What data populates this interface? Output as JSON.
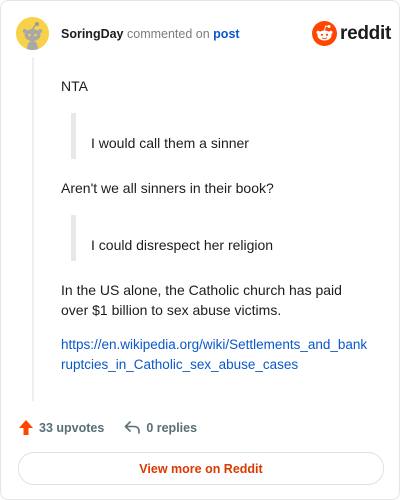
{
  "header": {
    "username": "SoringDay",
    "action_text": "commented on",
    "post_link": "post",
    "brand": "reddit"
  },
  "comment": {
    "p1": "NTA",
    "quote1": "I would call them a sinner",
    "p2": "Aren't we all sinners in their book?",
    "quote2": "I could disrespect her religion",
    "p3_line1": "In the US alone, the Catholic church has paid",
    "p3_line2": "over $1 billion to sex abuse victims.",
    "link": "https://en.wikipedia.org/wiki/Settlements_and_bankruptcies_in_Catholic_sex_abuse_cases"
  },
  "footer": {
    "upvotes": "33 upvotes",
    "replies": "0 replies",
    "view_more": "View more on Reddit"
  },
  "colors": {
    "upvote": "#ff4500",
    "link": "#0a58ca",
    "view_more": "#d93a00",
    "avatar": "#f7d14a"
  }
}
